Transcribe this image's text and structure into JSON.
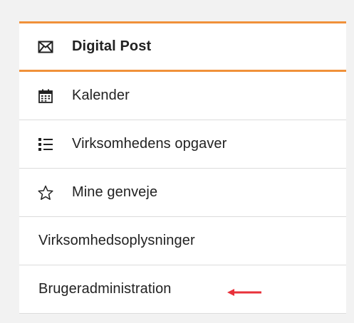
{
  "menu": {
    "accent_color": "#f0913a",
    "items": [
      {
        "label": "Digital Post",
        "icon": "mail-icon",
        "active": true
      },
      {
        "label": "Kalender",
        "icon": "calendar-icon"
      },
      {
        "label": "Virksomhedens opgaver",
        "icon": "task-list-icon"
      },
      {
        "label": "Mine genveje",
        "icon": "star-icon"
      },
      {
        "label": "Virksomhedsoplysninger"
      },
      {
        "label": "Brugeradministration",
        "annotation": "red-arrow-icon"
      }
    ]
  },
  "annotation": {
    "arrow_color": "#e8313a"
  }
}
